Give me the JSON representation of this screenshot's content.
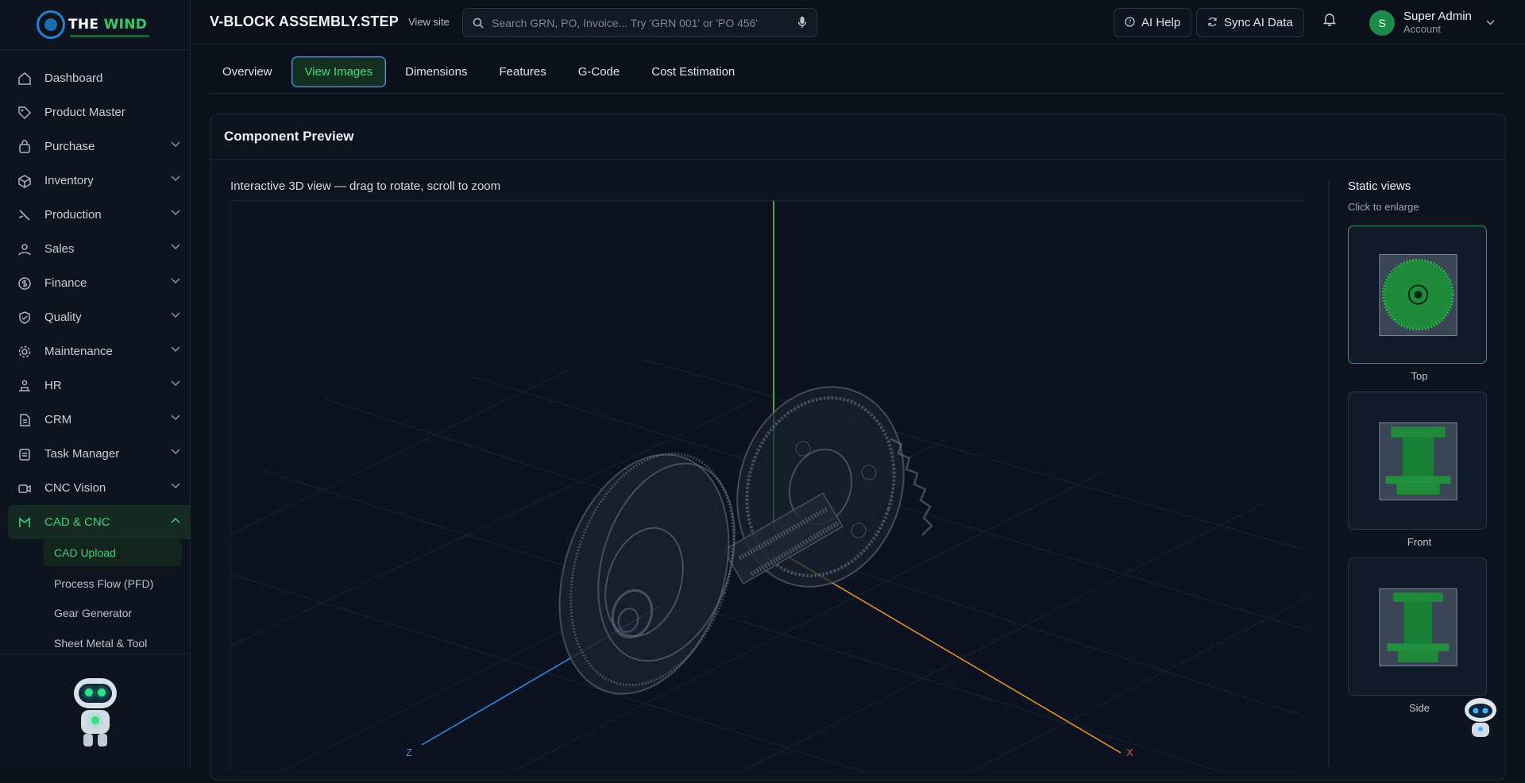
{
  "brand": {
    "name_prefix": "THE ",
    "name_accent": "WIND"
  },
  "sidebar": {
    "items": [
      {
        "label": "Dashboard",
        "icon": "home-icon",
        "expandable": false
      },
      {
        "label": "Product Master",
        "icon": "tag-icon",
        "expandable": false
      },
      {
        "label": "Purchase",
        "icon": "bag-icon",
        "expandable": true
      },
      {
        "label": "Inventory",
        "icon": "box-icon",
        "expandable": true
      },
      {
        "label": "Production",
        "icon": "hammer-icon",
        "expandable": true
      },
      {
        "label": "Sales",
        "icon": "users-icon",
        "expandable": true
      },
      {
        "label": "Finance",
        "icon": "dollar-icon",
        "expandable": true
      },
      {
        "label": "Quality",
        "icon": "shield-icon",
        "expandable": true
      },
      {
        "label": "Maintenance",
        "icon": "gear-icon",
        "expandable": true
      },
      {
        "label": "HR",
        "icon": "people-icon",
        "expandable": true
      },
      {
        "label": "CRM",
        "icon": "file-icon",
        "expandable": true
      },
      {
        "label": "Task Manager",
        "icon": "clipboard-icon",
        "expandable": true
      },
      {
        "label": "CNC Vision",
        "icon": "camera-icon",
        "expandable": true
      },
      {
        "label": "CAD & CNC",
        "icon": "cad-icon",
        "expandable": true,
        "active": true
      }
    ],
    "subitems": [
      {
        "label": "CAD Upload",
        "active": true
      },
      {
        "label": "Process Flow (PFD)"
      },
      {
        "label": "Gear Generator"
      },
      {
        "label": "Sheet Metal & Tool"
      }
    ]
  },
  "topbar": {
    "title": "V-BLOCK ASSEMBLY.STEP",
    "view_site": "View site",
    "search_placeholder": "Search GRN, PO, Invoice... Try 'GRN 001' or 'PO 456'",
    "ai_help": "AI Help",
    "sync": "Sync AI Data",
    "user": {
      "initial": "S",
      "name": "Super Admin",
      "role": "Account"
    }
  },
  "tabs": [
    {
      "label": "Overview"
    },
    {
      "label": "View Images",
      "active": true
    },
    {
      "label": "Dimensions"
    },
    {
      "label": "Features"
    },
    {
      "label": "G-Code"
    },
    {
      "label": "Cost Estimation"
    }
  ],
  "card": {
    "title": "Component Preview",
    "viewer_label": "Interactive 3D view — drag to rotate, scroll to zoom",
    "axes": {
      "z": "Z",
      "x": "X"
    },
    "static_title": "Static views",
    "static_hint": "Click to enlarge",
    "views": [
      {
        "label": "Top",
        "selected": true
      },
      {
        "label": "Front"
      },
      {
        "label": "Side"
      }
    ]
  },
  "colors": {
    "accent": "#3fd07a",
    "bg": "#0b101a",
    "axis_y": "#6cd63f",
    "axis_z": "#2f8fe8",
    "axis_x": "#f0962a"
  }
}
